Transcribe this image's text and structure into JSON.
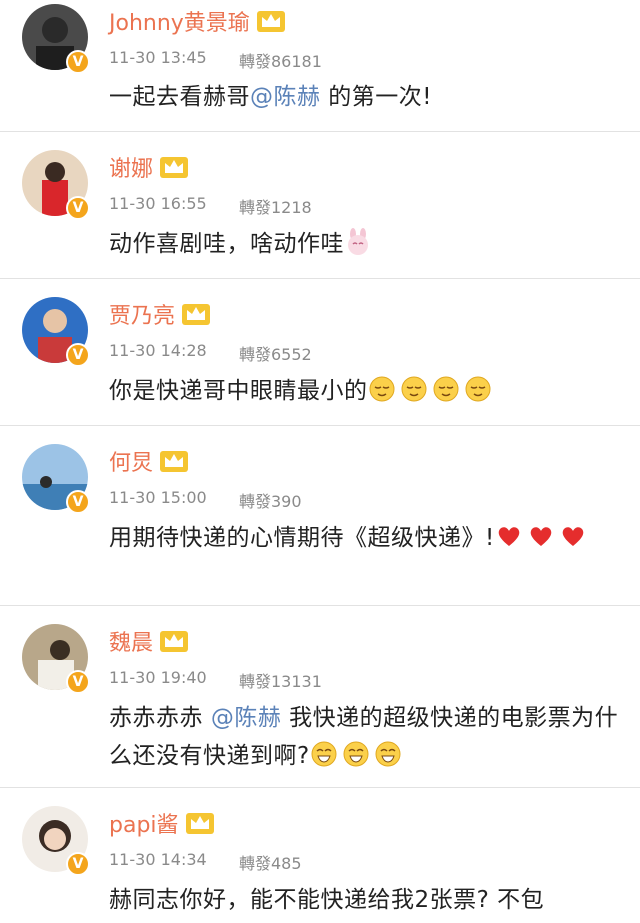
{
  "posts": [
    {
      "name": "Johnny黄景瑜",
      "time": "11-30 13:45",
      "reposts": "轉發86181",
      "text_a": "一起去看赫哥",
      "mention": "@陈赫",
      "text_b": " 的第一次!"
    },
    {
      "name": "谢娜",
      "time": "11-30 16:55",
      "reposts": "轉發1218",
      "text_a": "动作喜剧哇，啥动作哇"
    },
    {
      "name": "贾乃亮",
      "time": "11-30 14:28",
      "reposts": "轉發6552",
      "text_a": "你是快递哥中眼睛最小的"
    },
    {
      "name": "何炅",
      "time": "11-30 15:00",
      "reposts": "轉發390",
      "text_a": "用期待快递的心情期待《超级快递》!"
    },
    {
      "name": "魏晨",
      "time": "11-30 19:40",
      "reposts": "轉發13131",
      "text_a": "赤赤赤赤 ",
      "mention": "@陈赫",
      "text_b": " 我快递的超级快递的电影票为什么还没有快递到啊?"
    },
    {
      "name": "papi酱",
      "time": "11-30 14:34",
      "reposts": "轉發485",
      "text_a": "赫同志你好，能不能快递给我2张票? 不包"
    }
  ],
  "colors": {
    "name": "#eb7350",
    "mention": "#5b82b8",
    "meta": "#8a8a8a",
    "verified": "#f4a51c"
  },
  "icons": {
    "badge": "verified-v-icon",
    "level": "crown-icon",
    "emoji_bunny": "bunny-emoji-icon",
    "emoji_relieved": "relieved-emoji-icon",
    "emoji_heart": "heart-emoji-icon",
    "emoji_grin": "grin-emoji-icon"
  }
}
